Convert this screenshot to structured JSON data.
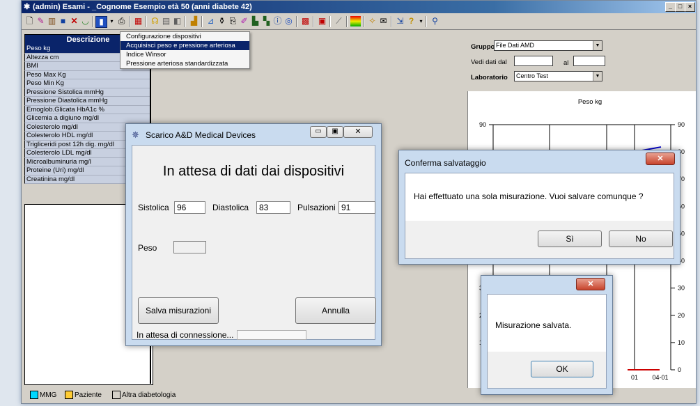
{
  "window": {
    "title": "(admin) Esami - _Cognome Esempio età 50 (anni diabete 42)",
    "min_label": "_",
    "max_label": "□",
    "close_label": "×"
  },
  "list": {
    "header": "Descrizione",
    "items": [
      "Peso kg",
      "Altezza cm",
      "BMI",
      "Peso Max Kg",
      "Peso Min Kg",
      "Pressione Sistolica mmHg",
      "Pressione Diastolica mmHg",
      "Emoglob.Glicata HbA1c %",
      "Glicemia a digiuno mg/dl",
      "Colesterolo mg/dl",
      "Colesterolo HDL mg/dl",
      "Trigliceridi post 12h dig. mg/dl",
      "Colesterolo LDL mg/dl",
      "Microalbuminuria mg/l",
      "Proteine (Uri) mg/dl",
      "Creatinina mg/dl"
    ]
  },
  "menu": {
    "items": [
      "Configurazione dispositivi",
      "Acquisisci peso e pressione arteriosa",
      "Indice Winsor",
      "Pressione arteriosa standardizzata"
    ]
  },
  "filters": {
    "gruppo_label": "Gruppo",
    "gruppo_value": "File Dati AMD",
    "vedi_label": "Vedi dati dal",
    "al_label": "al",
    "laboratorio_label": "Laboratorio",
    "laboratorio_value": "Centro Test"
  },
  "chart_data": {
    "type": "line",
    "title": "Peso kg",
    "xlabel": "",
    "ylabel": "",
    "ylim": [
      0,
      90
    ],
    "y_ticks_right": [
      90,
      80,
      70,
      60,
      50,
      40,
      30,
      20,
      10,
      0
    ],
    "y_ticks_left_visible": [
      90,
      30,
      20,
      10
    ],
    "x_tick_labels": [
      "01",
      "04-01"
    ],
    "series": [
      {
        "name": "",
        "color": "#0000cc",
        "values": [
          79.2,
          80.5,
          81.8
        ]
      },
      {
        "name": "",
        "color": "#cc0000",
        "values": [
          0,
          0
        ]
      }
    ]
  },
  "scarico": {
    "title": "Scarico A&D Medical Devices",
    "heading": "In attesa di dati dai dispositivi",
    "sistolica_label": "Sistolica",
    "sistolica_value": "96",
    "diastolica_label": "Diastolica",
    "diastolica_value": "83",
    "pulsazioni_label": "Pulsazioni",
    "pulsazioni_value": "91",
    "peso_label": "Peso",
    "peso_value": "",
    "save_label": "Salva misurazioni",
    "cancel_label": "Annulla",
    "status": "In attesa di connessione..."
  },
  "conferma": {
    "title": "Conferma salvataggio",
    "message": "Hai effettuato una sola misurazione. Vuoi salvare comunque ?",
    "yes_label": "Sì",
    "no_label": "No"
  },
  "saved": {
    "message": "Misurazione salvata.",
    "ok_label": "OK"
  },
  "legend": {
    "items": [
      {
        "label": "MMG",
        "color": "#00d8ff"
      },
      {
        "label": "Paziente",
        "color": "#ffcc33"
      },
      {
        "label": "Altra diabetologia",
        "color": "#d4d0c8"
      }
    ]
  }
}
